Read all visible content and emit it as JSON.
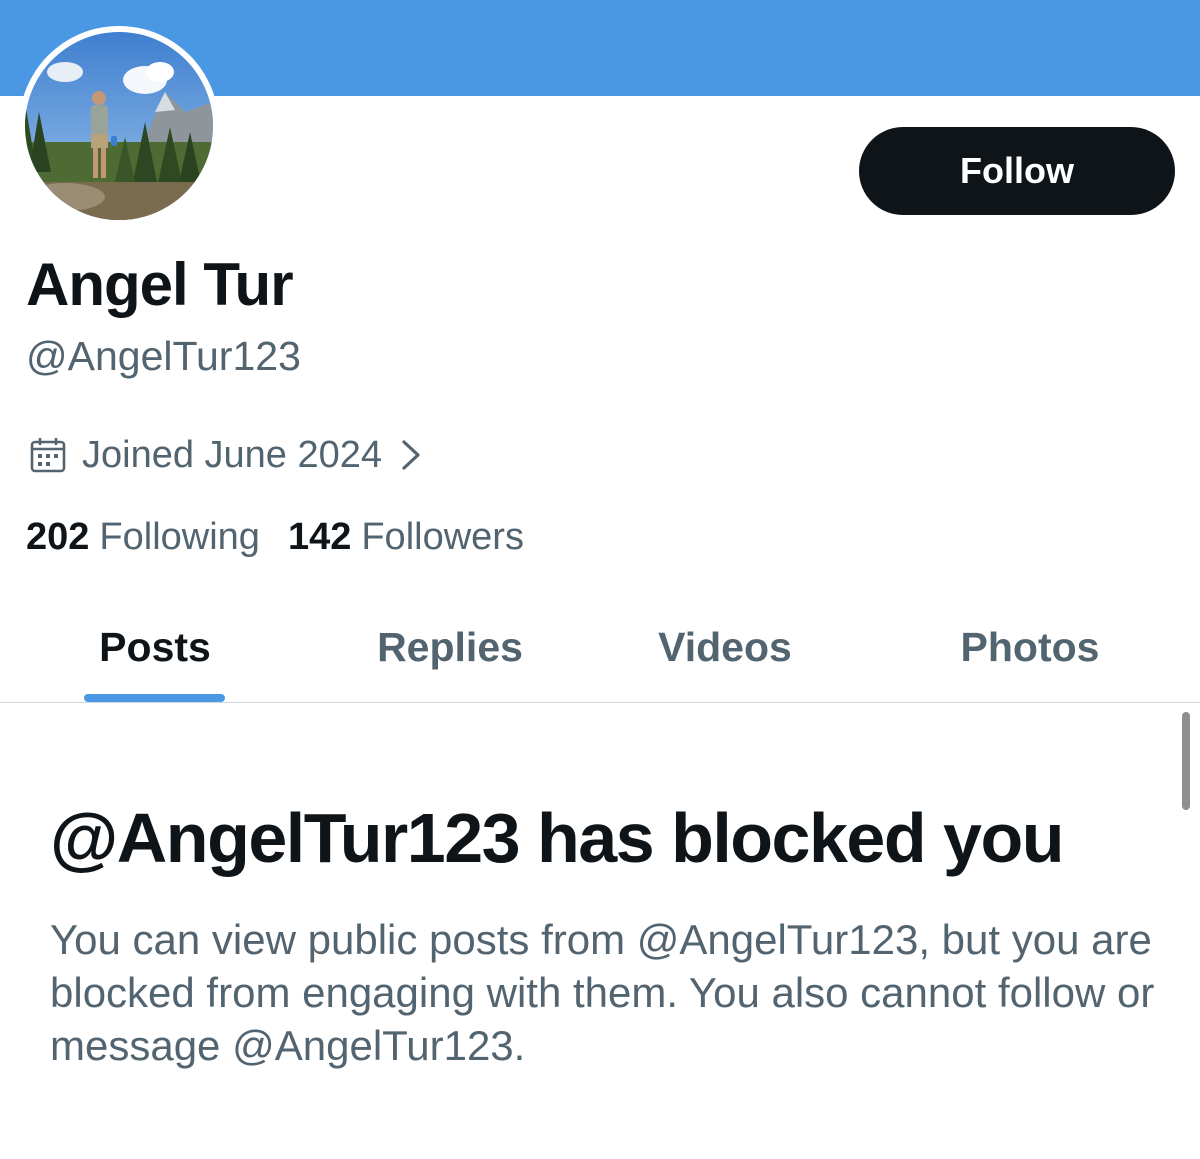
{
  "colors": {
    "banner": "#4a98e4",
    "accent": "#4a98e4",
    "primary_text": "#0f1419",
    "secondary_text": "#536471",
    "button_bg": "#0f1419",
    "button_text": "#ffffff"
  },
  "profile": {
    "display_name": "Angel Tur",
    "handle": "@AngelTur123",
    "avatar_icon": "profile-photo-mountain-hiker",
    "joined_icon": "calendar-icon",
    "joined_text": "Joined June 2024",
    "joined_chevron_icon": "chevron-right-icon"
  },
  "actions": {
    "follow_label": "Follow"
  },
  "stats": {
    "following_count": "202",
    "following_label": "Following",
    "followers_count": "142",
    "followers_label": "Followers"
  },
  "tabs": [
    {
      "label": "Posts",
      "active": true
    },
    {
      "label": "Replies",
      "active": false
    },
    {
      "label": "Videos",
      "active": false
    },
    {
      "label": "Photos",
      "active": false
    }
  ],
  "blocked": {
    "title": "@AngelTur123 has blocked you",
    "message": "You can view public posts from @AngelTur123, but you are blocked from engaging with them. You also cannot follow or message @AngelTur123."
  }
}
